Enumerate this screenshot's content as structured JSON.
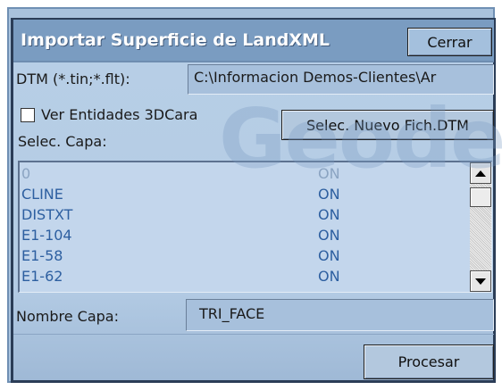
{
  "dialog": {
    "title": "Importar Superficie de LandXML",
    "close_label": "Cerrar"
  },
  "dtm": {
    "label": "DTM (*.tin;*.flt):",
    "path": "C:\\Informacion Demos-Clientes\\Ar"
  },
  "options": {
    "entities_3d_label": "Ver Entidades 3DCara",
    "entities_3d_checked": false,
    "new_file_label": "Selec. Nuevo Fich.DTM"
  },
  "layers": {
    "label": "Selec. Capa:",
    "items": [
      {
        "name": "0",
        "state": "ON"
      },
      {
        "name": "CLINE",
        "state": "ON"
      },
      {
        "name": "DISTXT",
        "state": "ON"
      },
      {
        "name": "E1-104",
        "state": "ON"
      },
      {
        "name": "E1-58",
        "state": "ON"
      },
      {
        "name": "E1-62",
        "state": "ON"
      }
    ]
  },
  "layer_name": {
    "label": "Nombre Capa:",
    "value": "TRI_FACE"
  },
  "actions": {
    "process_label": "Procesar"
  },
  "watermark": {
    "text": "Geodes"
  },
  "colors": {
    "title_bar": "#7a9cc1",
    "window_bg": "#b3cbe4",
    "list_bg": "#c3d6ec",
    "list_text": "#2d5fa0"
  }
}
